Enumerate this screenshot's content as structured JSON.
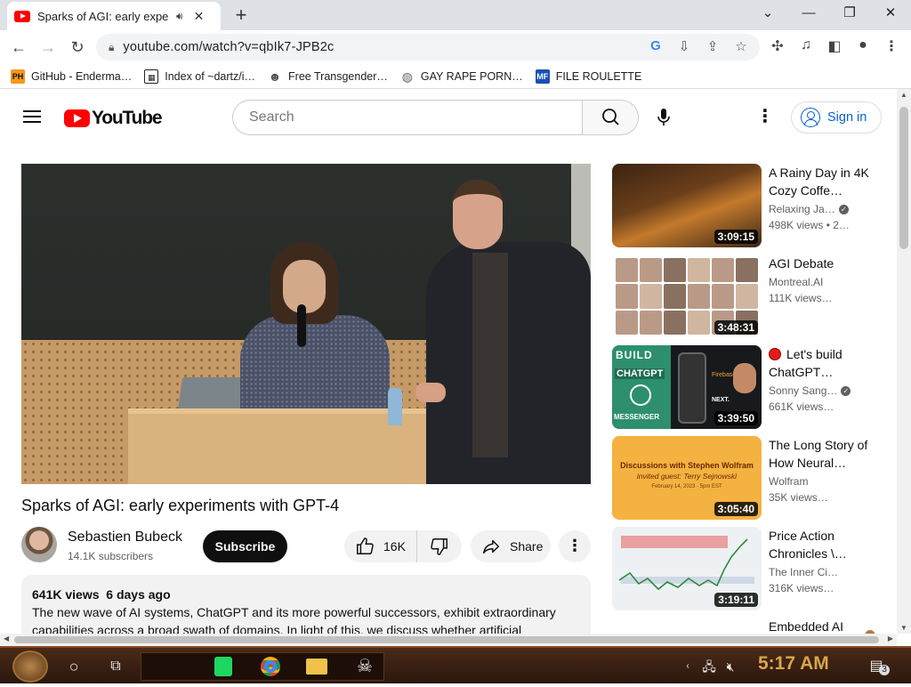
{
  "browser": {
    "tab_title": "Sparks of AGI: early expe",
    "new_tab": "+",
    "url": "youtube.com/watch?v=qbIk7-JPB2c",
    "window": {
      "minimize": "—",
      "restore": "❐",
      "close": "✕",
      "tabs_menu": "⌄"
    }
  },
  "bookmarks": [
    {
      "label": "GitHub - Enderma…",
      "icon": "PH",
      "color": "#f7971c"
    },
    {
      "label": "Index of ~dartz/i…",
      "icon": "▦",
      "color": "#222222"
    },
    {
      "label": "Free Transgender…",
      "icon": "☻",
      "color": "#555555"
    },
    {
      "label": "GAY RAPE PORN…",
      "icon": "◍",
      "color": "#666666"
    },
    {
      "label": "FILE ROULETTE",
      "icon": "MF",
      "color": "#1a4fb5"
    }
  ],
  "youtube": {
    "logo_text": "YouTube",
    "search_placeholder": "Search",
    "sign_in": "Sign in",
    "video": {
      "title": "Sparks of AGI: early experiments with GPT-4",
      "channel": "Sebastien Bubeck",
      "subscribers": "14.1K subscribers",
      "subscribe": "Subscribe",
      "likes": "16K",
      "share": "Share",
      "views": "641K views",
      "age": "6 days ago",
      "description": "The new wave of AI systems, ChatGPT and its more powerful successors, exhibit extraordinary capabilities across a broad swath of domains. In light of this, we discuss whether artificial"
    },
    "recommendations": [
      {
        "title": "A Rainy Day in 4K Cozy Coffe…",
        "channel": "Relaxing Ja…",
        "verified": true,
        "views": "498K views",
        "age": "2…",
        "duration": "3:09:15",
        "thumb": "cafe"
      },
      {
        "title": "AGI Debate",
        "channel": "Montreal.AI",
        "verified": false,
        "views": "111K views…",
        "age": "",
        "duration": "3:48:31",
        "thumb": "grid"
      },
      {
        "title": "Let's build ChatGPT…",
        "channel": "Sonny Sang…",
        "verified": true,
        "views": "661K views…",
        "age": "",
        "duration": "3:39:50",
        "thumb": "chatgpt",
        "live_dot": true,
        "thumb_text": {
          "build": "BUILD",
          "chatgpt": "CHATGPT",
          "messenger": "MESSENGER",
          "next": "NEXT.",
          "firebase": "Firebase"
        }
      },
      {
        "title": "The Long Story of How Neural…",
        "channel": "Wolfram",
        "verified": false,
        "views": "35K views…",
        "age": "",
        "duration": "3:05:40",
        "thumb": "wolfram",
        "thumb_text": {
          "line1": "Discussions with Stephen Wolfram",
          "line2": "invited guest: Terry Sejnowski",
          "line3": "February 14, 2023 · 5pm EST"
        }
      },
      {
        "title": "Price Action Chronicles \\…",
        "channel": "The Inner Ci…",
        "verified": false,
        "views": "316K views…",
        "age": "",
        "duration": "3:19:11",
        "thumb": "trade"
      },
      {
        "title": "Embedded AI",
        "channel": "",
        "verified": false,
        "views": "",
        "age": "",
        "duration": "",
        "thumb": "none"
      }
    ]
  },
  "taskbar": {
    "clock": "5:17 AM",
    "notification_count": "3"
  },
  "colors": {
    "youtube_red": "#ff0000",
    "link_blue": "#065fd4",
    "clock": "#d9a64a"
  }
}
